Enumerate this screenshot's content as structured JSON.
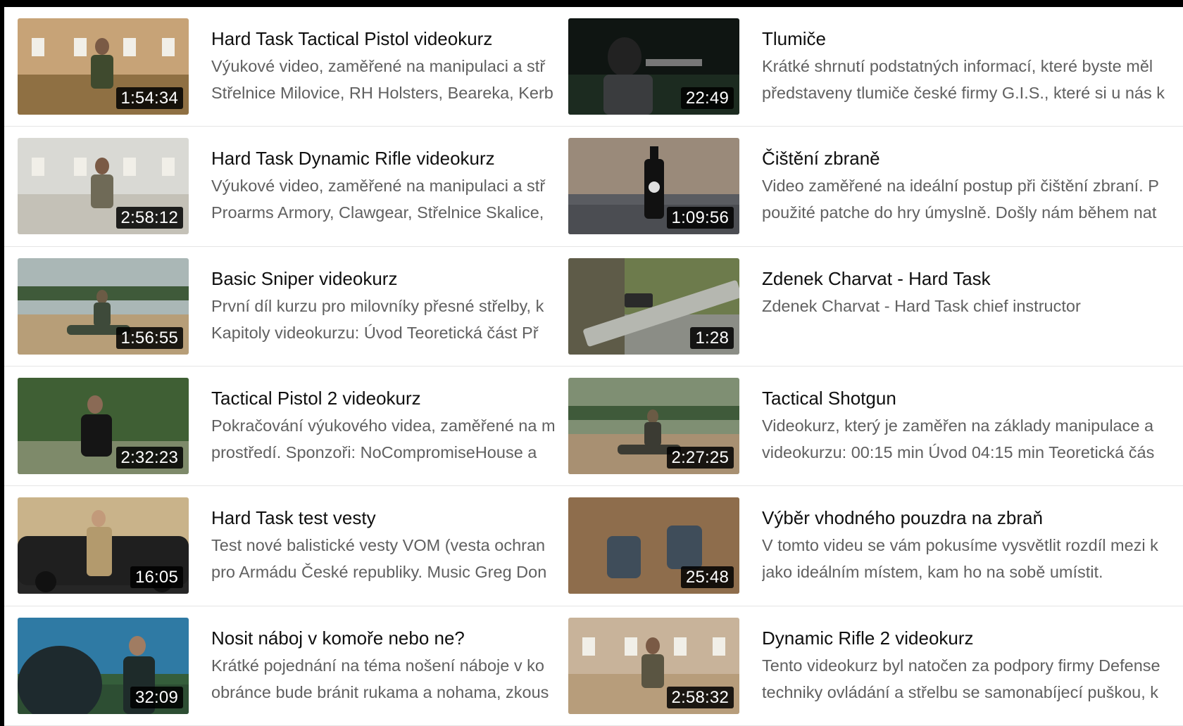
{
  "videos": [
    {
      "title": "Hard Task Tactical Pistol videokurz",
      "duration": "1:54:34",
      "desc1": "Výukové video, zaměřené na manipulaci a stř",
      "desc2": "Střelnice Milovice, RH Holsters, Beareka, Kerb",
      "thumb": {
        "sky": "#c7a377",
        "ground": "#8f7043",
        "accent": "#3f4a2e",
        "scene": "range"
      }
    },
    {
      "title": "Tlumiče",
      "duration": "22:49",
      "desc1": "Krátké shrnutí podstatných informací, které byste měl",
      "desc2": "představeny tlumiče české firmy G.I.S., které si u nás k",
      "thumb": {
        "sky": "#0f1512",
        "ground": "#1c2b20",
        "accent": "#3a3c3e",
        "scene": "dark"
      }
    },
    {
      "title": "Hard Task Dynamic Rifle videokurz",
      "duration": "2:58:12",
      "desc1": "Výukové video, zaměřené na manipulaci a stř",
      "desc2": "Proarms Armory, Clawgear, Střelnice Skalice,",
      "thumb": {
        "sky": "#d9d9d4",
        "ground": "#c4c1b7",
        "accent": "#6f6a57",
        "scene": "range"
      }
    },
    {
      "title": "Čištění zbraně",
      "duration": "1:09:56",
      "desc1": "Video zaměřené na ideální postup při čištění zbraní. P",
      "desc2": "použité patche do hry úmyslně. Došly nám během nat",
      "thumb": {
        "sky": "#9a8a7a",
        "ground": "#5a5c61",
        "accent": "#111111",
        "scene": "bottle"
      }
    },
    {
      "title": "Basic Sniper videokurz",
      "duration": "1:56:55",
      "desc1": "První díl kurzu pro milovníky přesné střelby, k",
      "desc2": "Kapitoly videokurzu: Úvod Teoretická část Př",
      "thumb": {
        "sky": "#aab7b6",
        "ground": "#b79e78",
        "accent": "#3e4a3a",
        "scene": "field"
      }
    },
    {
      "title": "Zdenek Charvat - Hard Task",
      "duration": "1:28",
      "desc1": "Zdenek Charvat - Hard Task chief instructor",
      "desc2": "",
      "thumb": {
        "sky": "#6d7b4c",
        "ground": "#8b8d86",
        "accent": "#2a2a2a",
        "scene": "rifle"
      }
    },
    {
      "title": "Tactical Pistol 2 videokurz",
      "duration": "2:32:23",
      "desc1": "Pokračování výukového videa, zaměřené na m",
      "desc2": "prostředí. Sponzoři: NoCompromiseHouse a",
      "thumb": {
        "sky": "#4c6a3a",
        "ground": "#7e8a6a",
        "accent": "#151515",
        "scene": "forest"
      }
    },
    {
      "title": "Tactical Shotgun",
      "duration": "2:27:25",
      "desc1": "Videokurz, který je zaměřen na základy manipulace a",
      "desc2": "videokurzu: 00:15 min Úvod 04:15 min Teoretická čás",
      "thumb": {
        "sky": "#7f8f73",
        "ground": "#a89072",
        "accent": "#3b3b33",
        "scene": "field"
      }
    },
    {
      "title": "Hard Task test vesty",
      "duration": "16:05",
      "desc1": "Test nové balistické vesty VOM (vesta ochran",
      "desc2": "pro Armádu České republiky. Music Greg Don",
      "thumb": {
        "sky": "#c9b38a",
        "ground": "#262626",
        "accent": "#b39a6d",
        "scene": "car"
      }
    },
    {
      "title": "Výběr vhodného pouzdra na zbraň",
      "duration": "25:48",
      "desc1": "V tomto videu se vám pokusíme vysvětlit rozdíl mezi k",
      "desc2": "jako ideálním místem, kam ho na sobě umístit.",
      "thumb": {
        "sky": "#8a6a48",
        "ground": "#a57e55",
        "accent": "#3f4d5a",
        "scene": "holster"
      }
    },
    {
      "title": "Nosit náboj v komoře nebo ne?",
      "duration": "32:09",
      "desc1": "Krátké pojednání na téma nošení náboje v ko",
      "desc2": "obránce bude bránit rukama a nohama, zkous",
      "thumb": {
        "sky": "#2f7aa4",
        "ground": "#355e3b",
        "accent": "#1e2b2a",
        "scene": "sky"
      }
    },
    {
      "title": "Dynamic Rifle 2 videokurz",
      "duration": "2:58:32",
      "desc1": "Tento videokurz byl natočen za podpory firmy Defense",
      "desc2": "techniky ovládání a střelbu se samonabíjecí puškou, k",
      "thumb": {
        "sky": "#c8b39a",
        "ground": "#b79d7b",
        "accent": "#5a5542",
        "scene": "range"
      }
    }
  ]
}
